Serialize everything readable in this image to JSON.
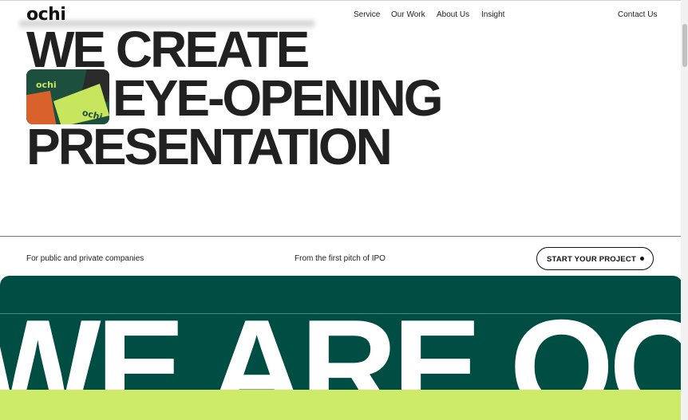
{
  "brand": {
    "logo_text": "ochi"
  },
  "nav": {
    "links": [
      "Service",
      "Our Work",
      "About Us",
      "Insight"
    ],
    "contact": "Contact Us"
  },
  "hero": {
    "lines": [
      "WE CREATE",
      "EYE-OPENING",
      "PRESENTATION"
    ],
    "thumbnail_logo": "ochi"
  },
  "info": {
    "left": "For public and private companies",
    "middle": "From the first pitch of IPO",
    "cta_label": "START YOUR PROJECT"
  },
  "marquee": {
    "text": "WE ARE OCHI"
  },
  "colors": {
    "dark_green": "#004d43",
    "lime": "#cdea68",
    "text": "#212121"
  }
}
